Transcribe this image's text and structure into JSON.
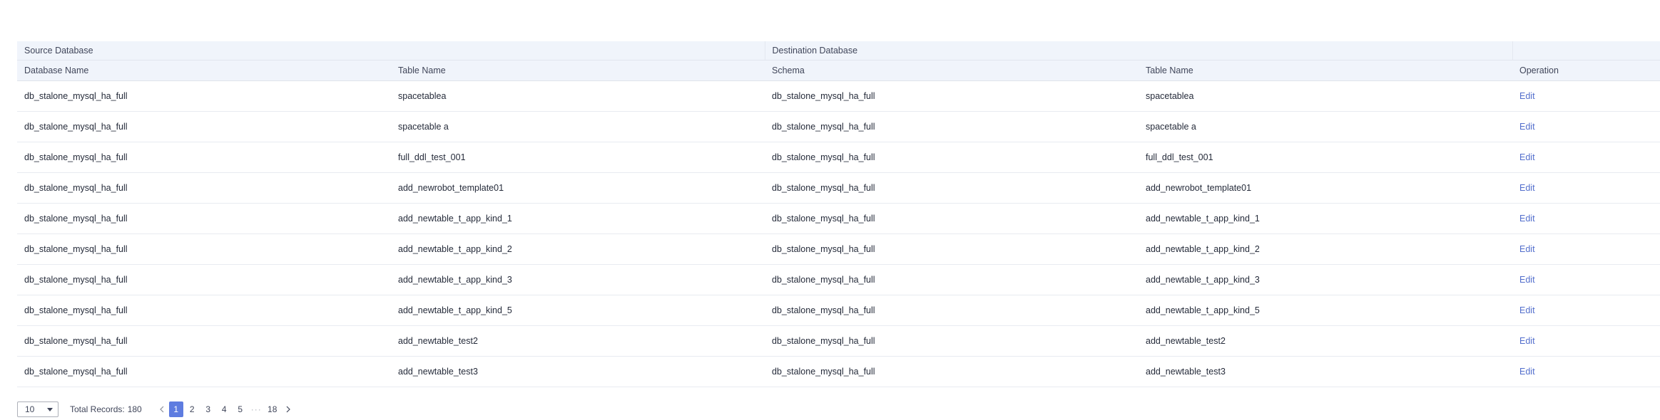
{
  "table": {
    "group_headers": [
      "Source Database",
      "Destination Database"
    ],
    "columns": [
      "Database Name",
      "Table Name",
      "Schema",
      "Table Name",
      "Operation"
    ],
    "rows": [
      [
        "db_stalone_mysql_ha_full",
        "spacetablea",
        "db_stalone_mysql_ha_full",
        "spacetablea",
        "Edit"
      ],
      [
        "db_stalone_mysql_ha_full",
        "spacetable a",
        "db_stalone_mysql_ha_full",
        "spacetable a",
        "Edit"
      ],
      [
        "db_stalone_mysql_ha_full",
        "full_ddl_test_001",
        "db_stalone_mysql_ha_full",
        "full_ddl_test_001",
        "Edit"
      ],
      [
        "db_stalone_mysql_ha_full",
        "add_newrobot_template01",
        "db_stalone_mysql_ha_full",
        "add_newrobot_template01",
        "Edit"
      ],
      [
        "db_stalone_mysql_ha_full",
        "add_newtable_t_app_kind_1",
        "db_stalone_mysql_ha_full",
        "add_newtable_t_app_kind_1",
        "Edit"
      ],
      [
        "db_stalone_mysql_ha_full",
        "add_newtable_t_app_kind_2",
        "db_stalone_mysql_ha_full",
        "add_newtable_t_app_kind_2",
        "Edit"
      ],
      [
        "db_stalone_mysql_ha_full",
        "add_newtable_t_app_kind_3",
        "db_stalone_mysql_ha_full",
        "add_newtable_t_app_kind_3",
        "Edit"
      ],
      [
        "db_stalone_mysql_ha_full",
        "add_newtable_t_app_kind_5",
        "db_stalone_mysql_ha_full",
        "add_newtable_t_app_kind_5",
        "Edit"
      ],
      [
        "db_stalone_mysql_ha_full",
        "add_newtable_test2",
        "db_stalone_mysql_ha_full",
        "add_newtable_test2",
        "Edit"
      ],
      [
        "db_stalone_mysql_ha_full",
        "add_newtable_test3",
        "db_stalone_mysql_ha_full",
        "add_newtable_test3",
        "Edit"
      ]
    ]
  },
  "pagination": {
    "page_size": "10",
    "total_label": "Total Records:",
    "total_count": "180",
    "pages": [
      "1",
      "2",
      "3",
      "4",
      "5",
      "···",
      "18"
    ],
    "current_page": "1",
    "prev_icon": "chevron-left-icon",
    "next_icon": "chevron-right-icon",
    "dropdown_icon": "caret-down-icon"
  },
  "colors": {
    "header_bg": "#f0f4fb",
    "link": "#526ecc",
    "active_page": "#5e7ce0"
  }
}
